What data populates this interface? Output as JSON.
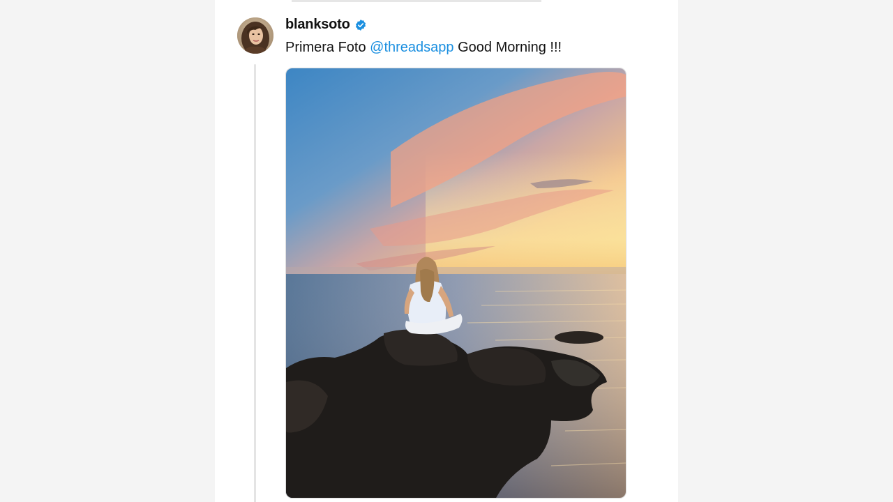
{
  "post": {
    "username": "blanksoto",
    "verified": true,
    "caption_prefix": "Primera Foto ",
    "mention": "@threadsapp",
    "caption_suffix": " Good Morning !!!",
    "avatar_icon": "profile-photo",
    "verified_icon": "verified-badge-icon",
    "photo_description_icon": "sunset-photo"
  },
  "colors": {
    "mention": "#1a8fe0",
    "verified": "#1a8fe0",
    "background": "#f4f4f4",
    "card": "#ffffff"
  }
}
